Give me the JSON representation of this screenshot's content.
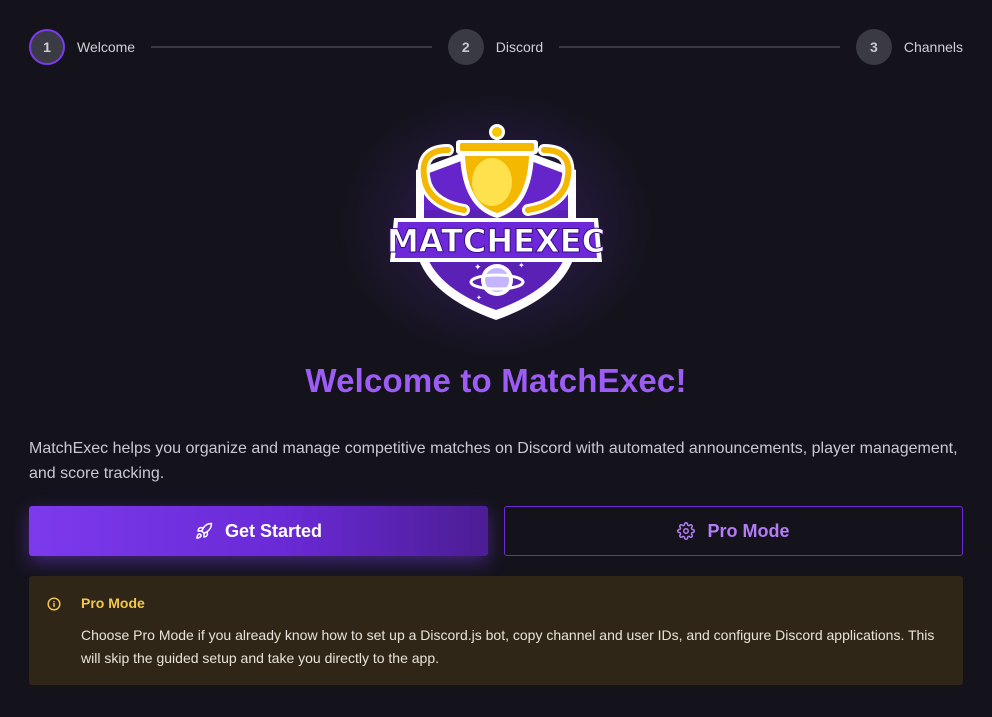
{
  "stepper": {
    "steps": [
      {
        "number": "1",
        "label": "Welcome"
      },
      {
        "number": "2",
        "label": "Discord"
      },
      {
        "number": "3",
        "label": "Channels"
      }
    ]
  },
  "logo": {
    "text": "MATCHEXEC",
    "icon": "trophy-shield-logo"
  },
  "main": {
    "title": "Welcome to MatchExec!",
    "description": "MatchExec helps you organize and manage competitive matches on Discord with automated announcements, player management, and score tracking."
  },
  "actions": {
    "get_started_label": "Get Started",
    "get_started_icon": "rocket-icon",
    "pro_mode_label": "Pro Mode",
    "pro_mode_icon": "gear-icon"
  },
  "info": {
    "icon": "info-icon",
    "title": "Pro Mode",
    "text": "Choose Pro Mode if you already know how to set up a Discord.js bot, copy channel and user IDs, and configure Discord applications. This will skip the guided setup and take you directly to the app."
  },
  "colors": {
    "accent": "#7c3aed",
    "title": "#9d5cf5",
    "background": "#14131c",
    "warning_bg": "#2f2617",
    "warning_title": "#f2c94c"
  }
}
